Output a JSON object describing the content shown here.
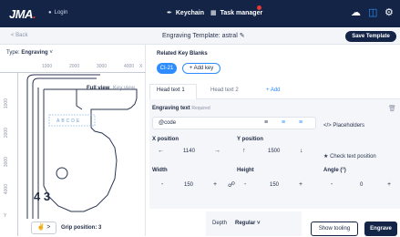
{
  "topbar": {
    "logo": "JMA",
    "login_label": "Login",
    "nav": [
      {
        "label": "Keychain",
        "icon": "pen-icon"
      },
      {
        "label": "Task manager",
        "icon": "grid-icon"
      }
    ],
    "icons": [
      "cloud-icon",
      "document-icon",
      "gear-icon"
    ]
  },
  "subbar": {
    "back_label": "< Back",
    "template_title": "Engraving Template: astral",
    "save_label": "Save Template"
  },
  "left_panel": {
    "type_label": "Type",
    "type_value": "Engraving",
    "ruler_x_ticks": [
      "1000",
      "2000",
      "3000",
      "4000"
    ],
    "ruler_x_unit": "X",
    "ruler_y_ticks": [
      "1000",
      "2000",
      "3000",
      "4000"
    ],
    "ruler_y_unit": "Y",
    "view_full": "Full view",
    "view_key": "Key view",
    "key_text": "ABCDE",
    "key_code": "4 3",
    "grip_label": "Grip position: 3"
  },
  "related": {
    "label": "Related Key Blanks",
    "chip": "CI-21",
    "add_key": "+ Add key"
  },
  "tabs": [
    {
      "label": "Head text 1",
      "active": true
    },
    {
      "label": "Head text 2",
      "active": false
    },
    {
      "label": "+ Add",
      "active": false
    }
  ],
  "engraving": {
    "label": "Engraving text",
    "required": "Required",
    "value": "@code",
    "placeholders": "Placeholders",
    "check_position": "Check text position",
    "x_label": "X position",
    "x_value": "1140",
    "y_label": "Y position",
    "y_value": "1500",
    "width_label": "Width",
    "width_value": "150",
    "height_label": "Height",
    "height_value": "150",
    "angle_label": "Angle (°)",
    "angle_value": "0"
  },
  "footer": {
    "depth_label": "Depth",
    "depth_value": "Regular",
    "show_tooling": "Show tooling",
    "engrave": "Engrave"
  },
  "colors": {
    "navy": "#132447",
    "accent": "#2d8cff",
    "badge": "#e53935"
  }
}
